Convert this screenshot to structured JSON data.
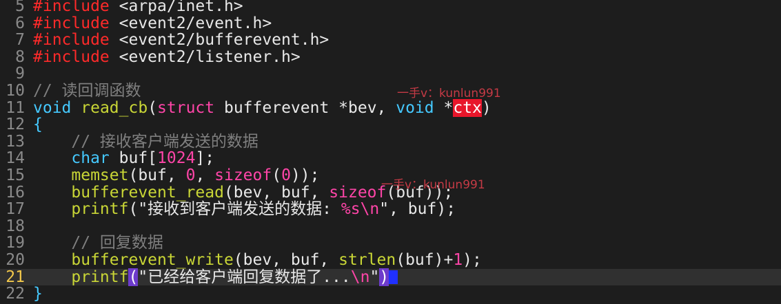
{
  "lines": [
    {
      "no": "5",
      "parts": [
        {
          "t": "#include",
          "c": "pp"
        },
        {
          "t": " <arpa/inet.h>",
          "c": "str"
        }
      ]
    },
    {
      "no": "6",
      "parts": [
        {
          "t": "#include",
          "c": "pp"
        },
        {
          "t": " <event2/event.h>",
          "c": "str"
        }
      ]
    },
    {
      "no": "7",
      "parts": [
        {
          "t": "#include",
          "c": "pp"
        },
        {
          "t": " <event2/bufferevent.h>",
          "c": "str"
        }
      ]
    },
    {
      "no": "8",
      "parts": [
        {
          "t": "#include",
          "c": "pp"
        },
        {
          "t": " <event2/listener.h>",
          "c": "str"
        }
      ]
    },
    {
      "no": "9",
      "parts": []
    },
    {
      "no": "10",
      "parts": [
        {
          "t": "// 读回调函数",
          "c": "cmt"
        }
      ]
    },
    {
      "no": "11",
      "parts": [
        {
          "t": "void",
          "c": "type"
        },
        {
          "t": " "
        },
        {
          "t": "read_cb",
          "c": "func"
        },
        {
          "t": "("
        },
        {
          "t": "struct",
          "c": "kw"
        },
        {
          "t": " bufferevent *bev, "
        },
        {
          "t": "void",
          "c": "type"
        },
        {
          "t": " *"
        },
        {
          "t": "ctx",
          "c": "err"
        },
        {
          "t": ")"
        }
      ]
    },
    {
      "no": "12",
      "parts": [
        {
          "t": "{",
          "c": "type"
        }
      ]
    },
    {
      "no": "13",
      "parts": [
        {
          "t": "    "
        },
        {
          "t": "// 接收客户端发送的数据",
          "c": "cmt"
        }
      ]
    },
    {
      "no": "14",
      "parts": [
        {
          "t": "    "
        },
        {
          "t": "char",
          "c": "type"
        },
        {
          "t": " buf["
        },
        {
          "t": "1024",
          "c": "num"
        },
        {
          "t": "];"
        }
      ]
    },
    {
      "no": "15",
      "parts": [
        {
          "t": "    "
        },
        {
          "t": "memset",
          "c": "func"
        },
        {
          "t": "(buf, "
        },
        {
          "t": "0",
          "c": "num"
        },
        {
          "t": ", "
        },
        {
          "t": "sizeof",
          "c": "kw"
        },
        {
          "t": "("
        },
        {
          "t": "0",
          "c": "num"
        },
        {
          "t": "));"
        }
      ]
    },
    {
      "no": "16",
      "parts": [
        {
          "t": "    "
        },
        {
          "t": "bufferevent_read",
          "c": "func"
        },
        {
          "t": "(bev, buf, "
        },
        {
          "t": "sizeof",
          "c": "kw"
        },
        {
          "t": "(buf));"
        }
      ]
    },
    {
      "no": "17",
      "parts": [
        {
          "t": "    "
        },
        {
          "t": "printf",
          "c": "func"
        },
        {
          "t": "(\"接收到客户端发送的数据: "
        },
        {
          "t": "%s\\n",
          "c": "esc"
        },
        {
          "t": "\", buf);"
        }
      ]
    },
    {
      "no": "18",
      "parts": []
    },
    {
      "no": "19",
      "parts": [
        {
          "t": "    "
        },
        {
          "t": "// 回复数据",
          "c": "cmt"
        }
      ]
    },
    {
      "no": "20",
      "parts": [
        {
          "t": "    "
        },
        {
          "t": "bufferevent_write",
          "c": "func"
        },
        {
          "t": "(bev, buf, "
        },
        {
          "t": "strlen",
          "c": "func"
        },
        {
          "t": "(buf)+"
        },
        {
          "t": "1",
          "c": "num"
        },
        {
          "t": ");"
        }
      ]
    },
    {
      "no": "21",
      "parts": [
        {
          "t": "    "
        },
        {
          "t": "printf",
          "c": "func"
        },
        {
          "t": "(",
          "c": "match"
        },
        {
          "t": "\"已经给客户端回复数据了..."
        },
        {
          "t": "\\n",
          "c": "esc"
        },
        {
          "t": "\""
        },
        {
          "t": ")",
          "c": "match"
        }
      ],
      "current": true,
      "cursor": true
    },
    {
      "no": "22",
      "parts": [
        {
          "t": "}",
          "c": "type"
        }
      ]
    }
  ],
  "watermarks": [
    {
      "text": "一手v：kunlun991"
    },
    {
      "text": "一手v：kunlun991"
    }
  ],
  "colors": {
    "background": "#1d1d1d",
    "current_line": "#303030",
    "preprocessor": "#ff2a2a",
    "type": "#45c9ff",
    "function": "#c9d636",
    "keyword": "#ff45a8",
    "comment": "#7f7f7f",
    "error_highlight": "#e8162b",
    "bracket_match": "#6d3bcc",
    "cursor": "#2030ff",
    "watermark": "#c53a45"
  }
}
